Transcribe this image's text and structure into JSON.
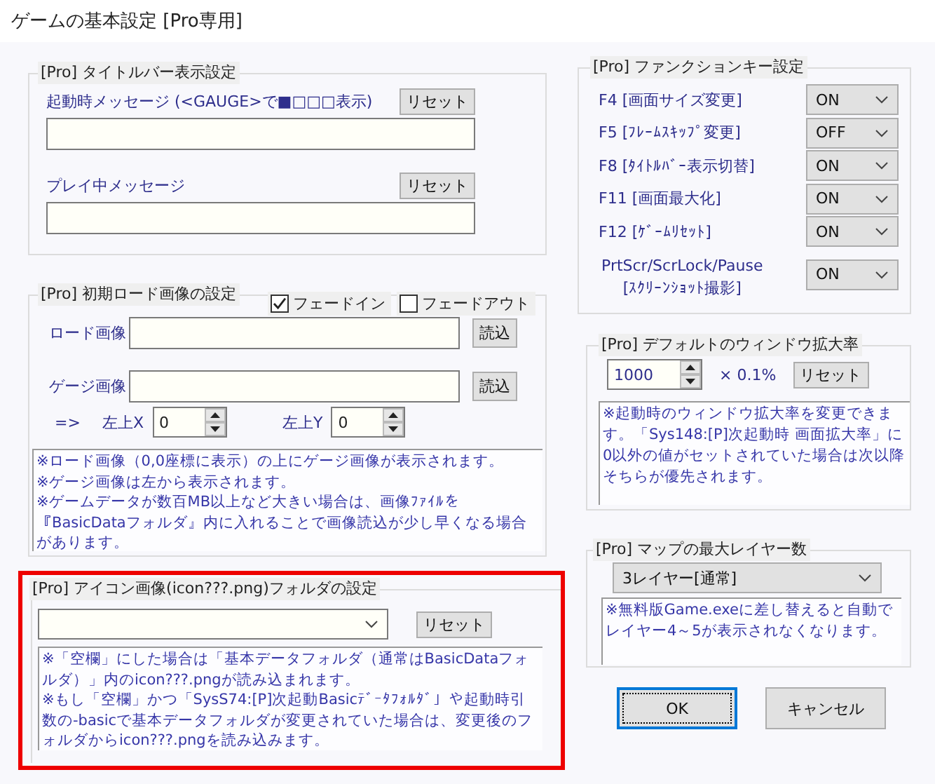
{
  "window": {
    "title": "ゲームの基本設定 [Pro専用]"
  },
  "titlebar_group": {
    "legend": "[Pro] タイトルバー表示設定",
    "fields": [
      {
        "label": "起動時メッセージ (<GAUGE>で■□□□表示)",
        "button": "リセット"
      },
      {
        "label": "プレイ中メッセージ",
        "button": "リセット"
      }
    ]
  },
  "load_image_group": {
    "legend": "[Pro] 初期ロード画像の設定",
    "checkboxes": [
      {
        "label": "フェードイン",
        "checked": true
      },
      {
        "label": "フェードアウト",
        "checked": false
      }
    ],
    "fields": [
      {
        "label": "ロード画像",
        "button": "読込"
      },
      {
        "label": "ゲージ画像",
        "button": "読込"
      }
    ],
    "offset_arrow": "=>",
    "offsets": [
      {
        "label": "左上X",
        "value": "0"
      },
      {
        "label": "左上Y",
        "value": "0"
      }
    ],
    "note": [
      "※ロード画像（0,0座標に表示）の上にゲージ画像が表示されます。",
      "※ゲージ画像は左から表示されます。",
      "※ゲームデータが数百MB以上など大きい場合は、画像ﾌｧｲﾙを『BasicDataフォルダ』内に入れることで画像読込が少し早くなる場合があります。"
    ]
  },
  "icon_folder_group": {
    "highlighted": true,
    "legend": "[Pro] アイコン画像(icon???.png)フォルダの設定",
    "button": "リセット",
    "note": [
      "※「空欄」にした場合は「基本データフォルダ（通常はBasicDataフォルダ）」内のicon???.pngが読み込まれます。",
      "※もし「空欄」かつ「SysS74:[P]次起動Basicﾃﾞｰﾀﾌｫﾙﾀﾞ」や起動時引数の-basicで基本データフォルダが変更されていた場合は、変更後のフォルダからicon???.pngを読み込みます。"
    ]
  },
  "function_key_group": {
    "legend": "[Pro] ファンクションキー設定",
    "keys": [
      {
        "label": "F4 [画面サイズ変更]",
        "value": "ON"
      },
      {
        "label": "F5 [ﾌﾚｰﾑｽｷｯﾌﾟ変更]",
        "value": "OFF"
      },
      {
        "label": "F8 [ﾀｲﾄﾙﾊﾞｰ表示切替]",
        "value": "ON"
      },
      {
        "label": "F11 [画面最大化]",
        "value": "ON"
      },
      {
        "label": "F12 [ｹﾞｰﾑﾘｾｯﾄ]",
        "value": "ON"
      },
      {
        "label": "PrtScr/ScrLock/Pause",
        "sublabel": "[ｽｸﾘｰﾝｼｮｯﾄ撮影]",
        "value": "ON"
      }
    ]
  },
  "zoom_group": {
    "legend": "[Pro] デフォルトのウィンドウ拡大率",
    "value": "1000",
    "unit": "× 0.1%",
    "button": "リセット",
    "note": "※起動時のウィンドウ拡大率を変更できます。「Sys148:[P]次起動時 画面拡大率」に0以外の値がセットされていた場合は次以降そちらが優先されます。"
  },
  "map_layer_group": {
    "legend": "[Pro] マップの最大レイヤー数",
    "value": "3レイヤー[通常]",
    "note": "※無料版Game.exeに差し替えると自動でレイヤー4～5が表示されなくなります。"
  },
  "buttons": [
    {
      "label": "OK",
      "focused": true
    },
    {
      "label": "キャンセル",
      "focused": false
    }
  ]
}
